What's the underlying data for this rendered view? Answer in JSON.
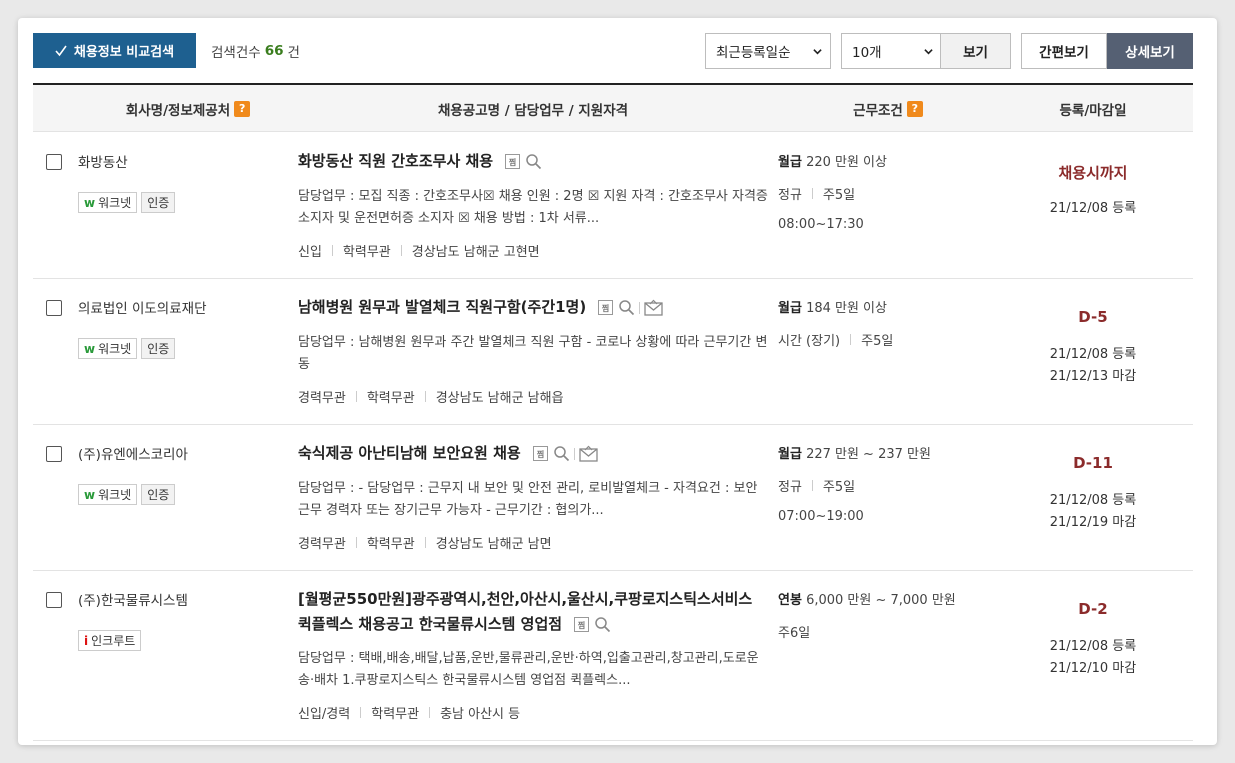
{
  "toolbar": {
    "compare_label": "채용정보 비교검색",
    "count_prefix": "검색건수",
    "count_value": "66",
    "count_suffix": "건",
    "sort_selected": "최근등록일순",
    "page_size_selected": "10개",
    "view_label": "보기",
    "mode_simple": "간편보기",
    "mode_detail": "상세보기"
  },
  "columns": {
    "company": "회사명/정보제공처",
    "job": "채용공고명 / 담당업무 / 지원자격",
    "conditions": "근무조건",
    "dates": "등록/마감일",
    "help_glyph": "?"
  },
  "badges": {
    "worknet": "워크넷",
    "verified": "인증",
    "incruit": "인크루트"
  },
  "icons": {
    "tag": "찜"
  },
  "rows": [
    {
      "company": "화방동산",
      "title": "화방동산 직원 간호조무사 채용",
      "duty": "담당업무 : 모집 직종 : 간호조무사☒ 채용 인원 : 2명 ☒ 지원 자격 : 간호조무사 자격증 소지자 및 운전면허증 소지자 ☒ 채용 방법 : 1차 서류...",
      "meta": [
        "신입",
        "학력무관",
        "경상남도 남해군 고현면"
      ],
      "pay_type": "월급",
      "pay_value": "220 만원 이상",
      "cond": [
        "정규",
        "주5일"
      ],
      "hours": "08:00~17:30",
      "deadline": "채용시까지",
      "registered": "21/12/08 등록",
      "closing": ""
    },
    {
      "company": "의료법인 이도의료재단",
      "title": "남해병원 원무과 발열체크 직원구함(주간1명)",
      "duty": "담당업무 : 남해병원 원무과 주간 발열체크 직원 구함 - 코로나 상황에 따라 근무기간 변동",
      "meta": [
        "경력무관",
        "학력무관",
        "경상남도 남해군 남해읍"
      ],
      "pay_type": "월급",
      "pay_value": "184 만원 이상",
      "cond": [
        "시간 (장기)",
        "주5일"
      ],
      "hours": "",
      "deadline": "D-5",
      "registered": "21/12/08 등록",
      "closing": "21/12/13 마감"
    },
    {
      "company": "(주)유엔에스코리아",
      "title": "숙식제공 아난티남해 보안요원 채용",
      "duty": "담당업무 : - 담당업무 : 근무지 내 보안 및 안전 관리, 로비발열체크 - 자격요건 : 보안근무 경력자 또는 장기근무 가능자 - 근무기간 : 협의가...",
      "meta": [
        "경력무관",
        "학력무관",
        "경상남도 남해군 남면"
      ],
      "pay_type": "월급",
      "pay_value": "227 만원 ~ 237 만원",
      "cond": [
        "정규",
        "주5일"
      ],
      "hours": "07:00~19:00",
      "deadline": "D-11",
      "registered": "21/12/08 등록",
      "closing": "21/12/19 마감"
    },
    {
      "company": "(주)한국물류시스템",
      "title": "[월평균550만원]광주광역시,천안,아산시,울산시,쿠팡로지스틱스서비스 퀵플렉스 채용공고 한국물류시스템 영업점",
      "duty": "담당업무 : 택배,배송,배달,납품,운반,물류관리,운반·하역,입출고관리,창고관리,도로운송·배차 1.쿠팡로지스틱스 한국물류시스템 영업점 퀵플렉스...",
      "meta": [
        "신입/경력",
        "학력무관",
        "충남 아산시 등"
      ],
      "pay_type": "연봉",
      "pay_value": "6,000 만원 ~ 7,000 만원",
      "cond": [
        "주6일"
      ],
      "hours": "",
      "deadline": "D-2",
      "registered": "21/12/08 등록",
      "closing": "21/12/10 마감"
    }
  ]
}
